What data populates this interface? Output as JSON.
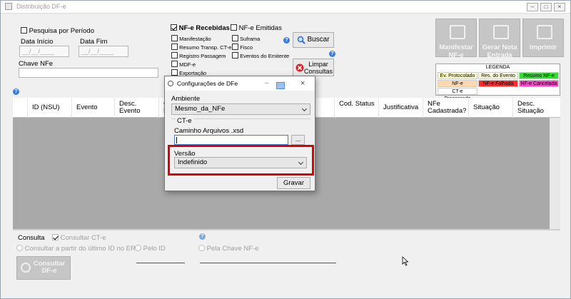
{
  "window": {
    "title": "Distribuição DF-e"
  },
  "filters": {
    "period_label": "Pesquisa por Período",
    "start_label": "Data Início",
    "end_label": "Data Fim",
    "start_value": "__/__/____",
    "end_value": "__/__/____",
    "key_label": "Chave NFe"
  },
  "nfe": {
    "received_label": "NF-e Recebidas",
    "issued_label": "NF-e Emitidas",
    "options_col1": [
      "Manifestação",
      "Resumo Transp. CT-e",
      "Registro Passagem",
      "MDF-e",
      "Exportação"
    ],
    "options_col2": [
      "Suframa",
      "Fisco",
      "Eventos do Emitente"
    ]
  },
  "buttons": {
    "search": "Buscar",
    "clear": "Limpar Consultas",
    "manifest": "Manifestar NF-e",
    "generate": "Gerar Nota Entrada",
    "print": "Imprimir"
  },
  "legend": {
    "title": "LEGENDA",
    "items": [
      {
        "label": "Ev. Protocolado",
        "color": "#ffffc8"
      },
      {
        "label": "Res. do Evento",
        "color": "#ffffe0"
      },
      {
        "label": "Resumo NF-e",
        "color": "#33dd33"
      },
      {
        "label": "NF-e Processada",
        "color": "#ffd8b0"
      },
      {
        "label": "NF-e Falhada",
        "color": "#ff2a2a"
      },
      {
        "label": "NF-e Cancelada",
        "color": "#ff44cc"
      },
      {
        "label": "CT-e Processado",
        "color": "#ffffff"
      }
    ]
  },
  "grid": {
    "columns": [
      "ID (NSU)",
      "Evento",
      "Desc. Evento",
      "C N",
      "Cod. Status",
      "Justificativa",
      "NFe Cadastrada?",
      "Situação",
      "Desc. Situação"
    ]
  },
  "consult": {
    "label": "Consulta",
    "cte_label": "Consultar CT-e",
    "opt_last_id": "Consultar a partir do último ID no ERP",
    "opt_by_id": "Pelo ID",
    "opt_by_key": "Pela Chave NF-e",
    "button": "Consultar DF-e"
  },
  "dialog": {
    "title": "Configurações de DFe",
    "ambiente_label": "Ambiente",
    "ambiente_value": "Mesmo_da_NFe",
    "cte_group": "CT-e",
    "path_label": "Caminho Arquivos .xsd",
    "browse": "...",
    "versao_label": "Versão",
    "versao_value": "Indefinido",
    "save": "Gravar"
  },
  "colors": {
    "highlight": "#e00000",
    "grid_bg": "#a9a9a9"
  }
}
